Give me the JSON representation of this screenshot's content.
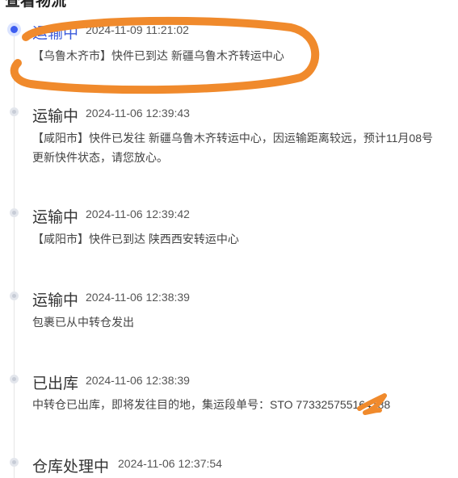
{
  "header": {
    "title": "查看物流",
    "close_label": "×"
  },
  "events": [
    {
      "status": "运输中",
      "time": "2024-11-09 11:21:02",
      "detail": "【乌鲁木齐市】快件已到达 新疆乌鲁木齐转运中心",
      "active": true
    },
    {
      "status": "运输中",
      "time": "2024-11-06 12:39:43",
      "detail": "【咸阳市】快件已发往 新疆乌鲁木齐转运中心，因运输距离较远，预计11月08号更新快件状态，请您放心。",
      "active": false
    },
    {
      "status": "运输中",
      "time": "2024-11-06 12:39:42",
      "detail": "【咸阳市】快件已到达 陕西西安转运中心",
      "active": false
    },
    {
      "status": "运输中",
      "time": "2024-11-06 12:38:39",
      "detail": "包裹已从中转仓发出",
      "active": false
    },
    {
      "status": "已出库",
      "time": "2024-11-06 12:38:39",
      "detail": "中转仓已出库，即将发往目的地，集运段单号：STO 773325755164188",
      "active": false
    },
    {
      "status": "仓库处理中",
      "time": "2024-11-06 12:37:54",
      "detail": "",
      "active": false
    }
  ],
  "colors": {
    "accent": "#3b5bdb",
    "annotation": "#f08a2c"
  },
  "icons": {
    "close": "close-icon",
    "active_dot": "timeline-dot-active-icon",
    "dot": "timeline-dot-icon"
  }
}
